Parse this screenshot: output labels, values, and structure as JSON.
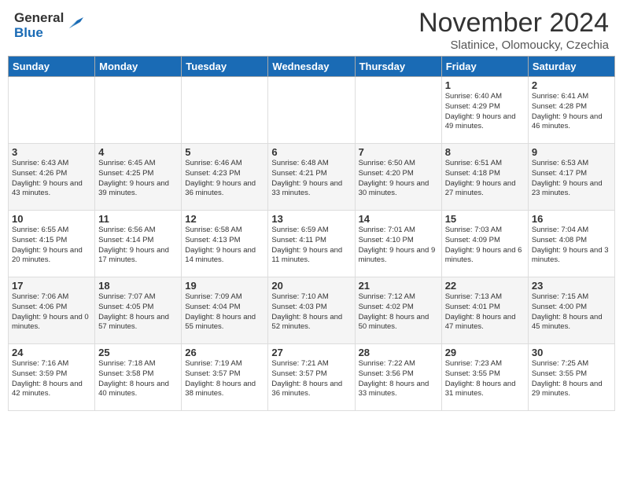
{
  "header": {
    "logo_general": "General",
    "logo_blue": "Blue",
    "month_title": "November 2024",
    "location": "Slatinice, Olomoucky, Czechia"
  },
  "days_of_week": [
    "Sunday",
    "Monday",
    "Tuesday",
    "Wednesday",
    "Thursday",
    "Friday",
    "Saturday"
  ],
  "weeks": [
    [
      {
        "day": "",
        "info": ""
      },
      {
        "day": "",
        "info": ""
      },
      {
        "day": "",
        "info": ""
      },
      {
        "day": "",
        "info": ""
      },
      {
        "day": "",
        "info": ""
      },
      {
        "day": "1",
        "info": "Sunrise: 6:40 AM\nSunset: 4:29 PM\nDaylight: 9 hours and 49 minutes."
      },
      {
        "day": "2",
        "info": "Sunrise: 6:41 AM\nSunset: 4:28 PM\nDaylight: 9 hours and 46 minutes."
      }
    ],
    [
      {
        "day": "3",
        "info": "Sunrise: 6:43 AM\nSunset: 4:26 PM\nDaylight: 9 hours and 43 minutes."
      },
      {
        "day": "4",
        "info": "Sunrise: 6:45 AM\nSunset: 4:25 PM\nDaylight: 9 hours and 39 minutes."
      },
      {
        "day": "5",
        "info": "Sunrise: 6:46 AM\nSunset: 4:23 PM\nDaylight: 9 hours and 36 minutes."
      },
      {
        "day": "6",
        "info": "Sunrise: 6:48 AM\nSunset: 4:21 PM\nDaylight: 9 hours and 33 minutes."
      },
      {
        "day": "7",
        "info": "Sunrise: 6:50 AM\nSunset: 4:20 PM\nDaylight: 9 hours and 30 minutes."
      },
      {
        "day": "8",
        "info": "Sunrise: 6:51 AM\nSunset: 4:18 PM\nDaylight: 9 hours and 27 minutes."
      },
      {
        "day": "9",
        "info": "Sunrise: 6:53 AM\nSunset: 4:17 PM\nDaylight: 9 hours and 23 minutes."
      }
    ],
    [
      {
        "day": "10",
        "info": "Sunrise: 6:55 AM\nSunset: 4:15 PM\nDaylight: 9 hours and 20 minutes."
      },
      {
        "day": "11",
        "info": "Sunrise: 6:56 AM\nSunset: 4:14 PM\nDaylight: 9 hours and 17 minutes."
      },
      {
        "day": "12",
        "info": "Sunrise: 6:58 AM\nSunset: 4:13 PM\nDaylight: 9 hours and 14 minutes."
      },
      {
        "day": "13",
        "info": "Sunrise: 6:59 AM\nSunset: 4:11 PM\nDaylight: 9 hours and 11 minutes."
      },
      {
        "day": "14",
        "info": "Sunrise: 7:01 AM\nSunset: 4:10 PM\nDaylight: 9 hours and 9 minutes."
      },
      {
        "day": "15",
        "info": "Sunrise: 7:03 AM\nSunset: 4:09 PM\nDaylight: 9 hours and 6 minutes."
      },
      {
        "day": "16",
        "info": "Sunrise: 7:04 AM\nSunset: 4:08 PM\nDaylight: 9 hours and 3 minutes."
      }
    ],
    [
      {
        "day": "17",
        "info": "Sunrise: 7:06 AM\nSunset: 4:06 PM\nDaylight: 9 hours and 0 minutes."
      },
      {
        "day": "18",
        "info": "Sunrise: 7:07 AM\nSunset: 4:05 PM\nDaylight: 8 hours and 57 minutes."
      },
      {
        "day": "19",
        "info": "Sunrise: 7:09 AM\nSunset: 4:04 PM\nDaylight: 8 hours and 55 minutes."
      },
      {
        "day": "20",
        "info": "Sunrise: 7:10 AM\nSunset: 4:03 PM\nDaylight: 8 hours and 52 minutes."
      },
      {
        "day": "21",
        "info": "Sunrise: 7:12 AM\nSunset: 4:02 PM\nDaylight: 8 hours and 50 minutes."
      },
      {
        "day": "22",
        "info": "Sunrise: 7:13 AM\nSunset: 4:01 PM\nDaylight: 8 hours and 47 minutes."
      },
      {
        "day": "23",
        "info": "Sunrise: 7:15 AM\nSunset: 4:00 PM\nDaylight: 8 hours and 45 minutes."
      }
    ],
    [
      {
        "day": "24",
        "info": "Sunrise: 7:16 AM\nSunset: 3:59 PM\nDaylight: 8 hours and 42 minutes."
      },
      {
        "day": "25",
        "info": "Sunrise: 7:18 AM\nSunset: 3:58 PM\nDaylight: 8 hours and 40 minutes."
      },
      {
        "day": "26",
        "info": "Sunrise: 7:19 AM\nSunset: 3:57 PM\nDaylight: 8 hours and 38 minutes."
      },
      {
        "day": "27",
        "info": "Sunrise: 7:21 AM\nSunset: 3:57 PM\nDaylight: 8 hours and 36 minutes."
      },
      {
        "day": "28",
        "info": "Sunrise: 7:22 AM\nSunset: 3:56 PM\nDaylight: 8 hours and 33 minutes."
      },
      {
        "day": "29",
        "info": "Sunrise: 7:23 AM\nSunset: 3:55 PM\nDaylight: 8 hours and 31 minutes."
      },
      {
        "day": "30",
        "info": "Sunrise: 7:25 AM\nSunset: 3:55 PM\nDaylight: 8 hours and 29 minutes."
      }
    ]
  ]
}
